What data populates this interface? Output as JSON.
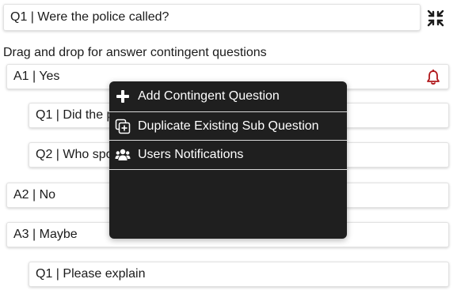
{
  "question": {
    "title": "Q1 | Were the police called?"
  },
  "instructions": "Drag and drop for answer contingent questions",
  "answers": [
    {
      "label": "A1 | Yes"
    },
    {
      "label": "A2 | No"
    },
    {
      "label": "A3 | Maybe"
    }
  ],
  "sub_questions": [
    {
      "label": "Q1 | Did the police come?"
    },
    {
      "label": "Q2 | Who spoke to the police?"
    },
    {
      "label": "Q1 | Please explain"
    }
  ],
  "context_menu": {
    "items": [
      {
        "label": "Add Contingent Question",
        "icon": "plus-icon"
      },
      {
        "label": "Duplicate Existing Sub Question",
        "icon": "duplicate-icon"
      },
      {
        "label": "Users Notifications",
        "icon": "users-icon"
      }
    ]
  },
  "colors": {
    "bell": "#b0171b",
    "menu_bg": "#1f1f1f"
  }
}
